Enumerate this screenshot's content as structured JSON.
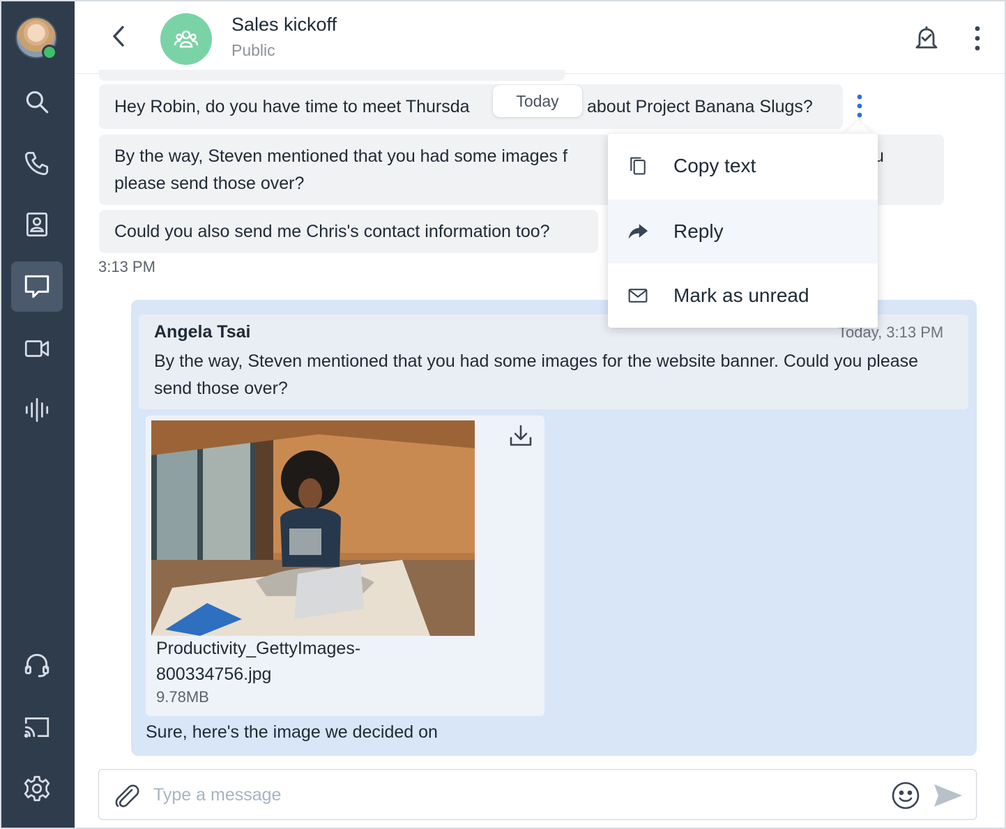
{
  "sidebar": {
    "nav": [
      {
        "name": "search-icon"
      },
      {
        "name": "phone-icon"
      },
      {
        "name": "contacts-icon"
      },
      {
        "name": "chat-icon",
        "active": true
      },
      {
        "name": "video-icon"
      },
      {
        "name": "voicemail-icon"
      },
      {
        "name": "headset-icon"
      },
      {
        "name": "cast-icon"
      },
      {
        "name": "settings-icon"
      }
    ],
    "presence_color": "#3fc06b"
  },
  "header": {
    "title": "Sales kickoff",
    "subtitle": "Public",
    "room_icon_color": "#79d3a6"
  },
  "messages": {
    "m1": "Hey Robin, do you have time to meet Thursda",
    "m1_tail": "about Project Banana Slugs?",
    "m2_line1": "By the way, Steven mentioned that you had some images f",
    "m2_tail": "u",
    "m2_line2": "please send those over?",
    "m3": "Could you also send me Chris's contact information too?",
    "time": "3:13 PM",
    "date_chip": "Today"
  },
  "context_menu": {
    "items": [
      {
        "label": "Copy text",
        "icon": "copy-icon"
      },
      {
        "label": "Reply",
        "icon": "reply-icon"
      },
      {
        "label": "Mark as unread",
        "icon": "envelope-icon"
      }
    ]
  },
  "reply": {
    "quote_author": "Angela Tsai",
    "quote_time": "Today, 3:13 PM",
    "quote_text": "By the way, Steven mentioned that you had some images for the website banner. Could you please send those over?",
    "file_name": "Productivity_GettyImages-800334756.jpg",
    "file_size": "9.78MB",
    "text": "Sure, here's the image we decided on",
    "card_color": "#d8e6f7"
  },
  "composer": {
    "placeholder": "Type a message",
    "value": ""
  },
  "colors": {
    "sidebar": "#2f3c4c",
    "accent": "#2f6fd6"
  }
}
